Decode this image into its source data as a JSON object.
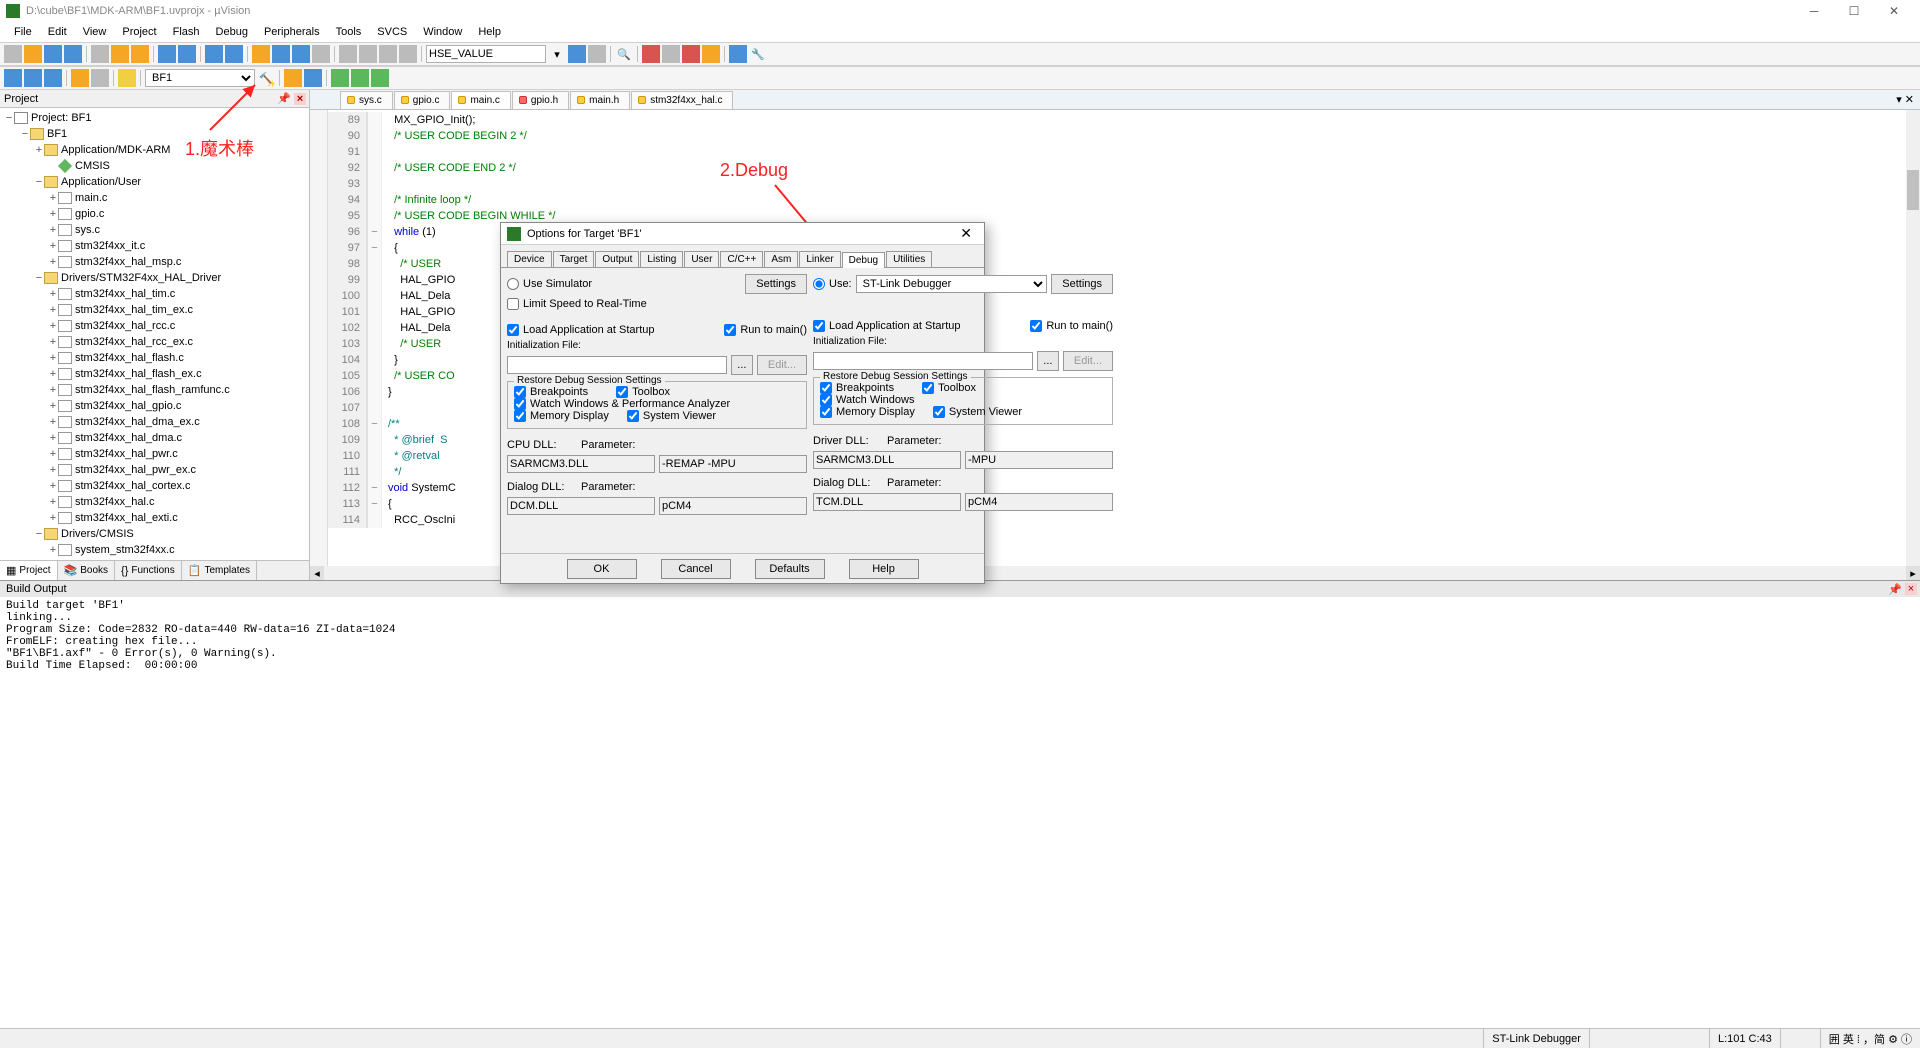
{
  "titlebar": {
    "title": "D:\\cube\\BF1\\MDK-ARM\\BF1.uvprojx - µVision"
  },
  "menu": [
    "File",
    "Edit",
    "View",
    "Project",
    "Flash",
    "Debug",
    "Peripherals",
    "Tools",
    "SVCS",
    "Window",
    "Help"
  ],
  "toolbar2": {
    "target": "BF1",
    "combo1": "HSE_VALUE"
  },
  "project_panel": {
    "title": "Project",
    "tabs": [
      "Project",
      "Books",
      "Functions",
      "Templates"
    ],
    "root": "Project: BF1",
    "tree": [
      {
        "d": 1,
        "t": "fold",
        "exp": "−",
        "txt": "BF1"
      },
      {
        "d": 2,
        "t": "fold",
        "exp": "+",
        "txt": "Application/MDK-ARM"
      },
      {
        "d": 3,
        "t": "diamond",
        "txt": "CMSIS"
      },
      {
        "d": 2,
        "t": "fold",
        "exp": "−",
        "txt": "Application/User"
      },
      {
        "d": 3,
        "t": "file",
        "exp": "+",
        "txt": "main.c"
      },
      {
        "d": 3,
        "t": "file",
        "exp": "+",
        "txt": "gpio.c"
      },
      {
        "d": 3,
        "t": "file",
        "exp": "+",
        "txt": "sys.c"
      },
      {
        "d": 3,
        "t": "file",
        "exp": "+",
        "txt": "stm32f4xx_it.c"
      },
      {
        "d": 3,
        "t": "file",
        "exp": "+",
        "txt": "stm32f4xx_hal_msp.c"
      },
      {
        "d": 2,
        "t": "fold",
        "exp": "−",
        "txt": "Drivers/STM32F4xx_HAL_Driver"
      },
      {
        "d": 3,
        "t": "file",
        "exp": "+",
        "txt": "stm32f4xx_hal_tim.c"
      },
      {
        "d": 3,
        "t": "file",
        "exp": "+",
        "txt": "stm32f4xx_hal_tim_ex.c"
      },
      {
        "d": 3,
        "t": "file",
        "exp": "+",
        "txt": "stm32f4xx_hal_rcc.c"
      },
      {
        "d": 3,
        "t": "file",
        "exp": "+",
        "txt": "stm32f4xx_hal_rcc_ex.c"
      },
      {
        "d": 3,
        "t": "file",
        "exp": "+",
        "txt": "stm32f4xx_hal_flash.c"
      },
      {
        "d": 3,
        "t": "file",
        "exp": "+",
        "txt": "stm32f4xx_hal_flash_ex.c"
      },
      {
        "d": 3,
        "t": "file",
        "exp": "+",
        "txt": "stm32f4xx_hal_flash_ramfunc.c"
      },
      {
        "d": 3,
        "t": "file",
        "exp": "+",
        "txt": "stm32f4xx_hal_gpio.c"
      },
      {
        "d": 3,
        "t": "file",
        "exp": "+",
        "txt": "stm32f4xx_hal_dma_ex.c"
      },
      {
        "d": 3,
        "t": "file",
        "exp": "+",
        "txt": "stm32f4xx_hal_dma.c"
      },
      {
        "d": 3,
        "t": "file",
        "exp": "+",
        "txt": "stm32f4xx_hal_pwr.c"
      },
      {
        "d": 3,
        "t": "file",
        "exp": "+",
        "txt": "stm32f4xx_hal_pwr_ex.c"
      },
      {
        "d": 3,
        "t": "file",
        "exp": "+",
        "txt": "stm32f4xx_hal_cortex.c"
      },
      {
        "d": 3,
        "t": "file",
        "exp": "+",
        "txt": "stm32f4xx_hal.c"
      },
      {
        "d": 3,
        "t": "file",
        "exp": "+",
        "txt": "stm32f4xx_hal_exti.c"
      },
      {
        "d": 2,
        "t": "fold",
        "exp": "−",
        "txt": "Drivers/CMSIS"
      },
      {
        "d": 3,
        "t": "file",
        "exp": "+",
        "txt": "system_stm32f4xx.c"
      }
    ]
  },
  "editor_tabs": [
    {
      "name": "sys.c",
      "kind": "c"
    },
    {
      "name": "gpio.c",
      "kind": "c"
    },
    {
      "name": "main.c",
      "kind": "c",
      "active": true
    },
    {
      "name": "gpio.h",
      "kind": "h"
    },
    {
      "name": "main.h",
      "kind": "c"
    },
    {
      "name": "stm32f4xx_hal.c",
      "kind": "c"
    }
  ],
  "code": [
    {
      "n": 89,
      "g": "",
      "segs": [
        {
          "c": "fn",
          "t": "  MX_GPIO_Init"
        },
        {
          "c": "",
          "t": "();"
        }
      ]
    },
    {
      "n": 90,
      "g": "",
      "segs": [
        {
          "c": "comm",
          "t": "  /* USER CODE BEGIN 2 */"
        }
      ]
    },
    {
      "n": 91,
      "g": "",
      "segs": [
        {
          "c": "",
          "t": ""
        }
      ]
    },
    {
      "n": 92,
      "g": "",
      "segs": [
        {
          "c": "comm",
          "t": "  /* USER CODE END 2 */"
        }
      ]
    },
    {
      "n": 93,
      "g": "",
      "segs": [
        {
          "c": "",
          "t": ""
        }
      ]
    },
    {
      "n": 94,
      "g": "",
      "segs": [
        {
          "c": "comm",
          "t": "  /* Infinite loop */"
        }
      ]
    },
    {
      "n": 95,
      "g": "",
      "segs": [
        {
          "c": "comm",
          "t": "  /* USER CODE BEGIN WHILE */"
        }
      ]
    },
    {
      "n": 96,
      "g": "−",
      "segs": [
        {
          "c": "kw",
          "t": "  while"
        },
        {
          "c": "",
          "t": " (1)"
        }
      ]
    },
    {
      "n": 97,
      "g": "−",
      "segs": [
        {
          "c": "",
          "t": "  {"
        }
      ]
    },
    {
      "n": 98,
      "g": "",
      "segs": [
        {
          "c": "comm",
          "t": "    /* USER"
        }
      ]
    },
    {
      "n": 99,
      "g": "",
      "segs": [
        {
          "c": "",
          "t": "    HAL_GPIO"
        }
      ]
    },
    {
      "n": 100,
      "g": "",
      "segs": [
        {
          "c": "",
          "t": "    HAL_Dela"
        }
      ]
    },
    {
      "n": 101,
      "g": "",
      "segs": [
        {
          "c": "",
          "t": "    HAL_GPIO"
        }
      ]
    },
    {
      "n": 102,
      "g": "",
      "segs": [
        {
          "c": "",
          "t": "    HAL_Dela"
        }
      ]
    },
    {
      "n": 103,
      "g": "",
      "segs": [
        {
          "c": "comm",
          "t": "    /* USER"
        }
      ]
    },
    {
      "n": 104,
      "g": "",
      "segs": [
        {
          "c": "",
          "t": "  }"
        }
      ]
    },
    {
      "n": 105,
      "g": "",
      "segs": [
        {
          "c": "comm",
          "t": "  /* USER CO"
        }
      ]
    },
    {
      "n": 106,
      "g": "",
      "segs": [
        {
          "c": "",
          "t": "}"
        }
      ]
    },
    {
      "n": 107,
      "g": "",
      "segs": [
        {
          "c": "",
          "t": ""
        }
      ]
    },
    {
      "n": 108,
      "g": "−",
      "segs": [
        {
          "c": "doc",
          "t": "/**"
        }
      ]
    },
    {
      "n": 109,
      "g": "",
      "segs": [
        {
          "c": "doc",
          "t": "  * @brief  S"
        }
      ]
    },
    {
      "n": 110,
      "g": "",
      "segs": [
        {
          "c": "doc",
          "t": "  * @retval"
        }
      ]
    },
    {
      "n": 111,
      "g": "",
      "segs": [
        {
          "c": "doc",
          "t": "  */"
        }
      ]
    },
    {
      "n": 112,
      "g": "−",
      "segs": [
        {
          "c": "kw",
          "t": "void"
        },
        {
          "c": "",
          "t": " SystemC"
        }
      ]
    },
    {
      "n": 113,
      "g": "−",
      "segs": [
        {
          "c": "",
          "t": "{"
        }
      ]
    },
    {
      "n": 114,
      "g": "",
      "segs": [
        {
          "c": "",
          "t": "  RCC_OscIni"
        }
      ]
    }
  ],
  "annotations": {
    "a1": "1.魔术棒",
    "a2": "2.Debug"
  },
  "dialog": {
    "title": "Options for Target 'BF1'",
    "tabs": [
      "Device",
      "Target",
      "Output",
      "Listing",
      "User",
      "C/C++",
      "Asm",
      "Linker",
      "Debug",
      "Utilities"
    ],
    "active_tab": "Debug",
    "left": {
      "use_sim": "Use Simulator",
      "settings": "Settings",
      "limit_speed": "Limit Speed to Real-Time",
      "load_startup": "Load Application at Startup",
      "run_main": "Run to main()",
      "init_file": "Initialization File:",
      "browse": "...",
      "edit": "Edit...",
      "restore_title": "Restore Debug Session Settings",
      "breakpoints": "Breakpoints",
      "toolbox": "Toolbox",
      "watch_perf": "Watch Windows & Performance Analyzer",
      "mem_disp": "Memory Display",
      "sys_viewer": "System Viewer",
      "cpu_dll_l": "CPU DLL:",
      "param_l": "Parameter:",
      "cpu_dll": "SARMCM3.DLL",
      "cpu_param": "-REMAP -MPU",
      "dlg_dll_l": "Dialog DLL:",
      "dlg_dll": "DCM.DLL",
      "dlg_param": "pCM4"
    },
    "right": {
      "use": "Use:",
      "debugger": "ST-Link Debugger",
      "settings": "Settings",
      "load_startup": "Load Application at Startup",
      "run_main": "Run to main()",
      "init_file": "Initialization File:",
      "browse": "...",
      "edit": "Edit...",
      "restore_title": "Restore Debug Session Settings",
      "breakpoints": "Breakpoints",
      "toolbox": "Toolbox",
      "watch": "Watch Windows",
      "mem_disp": "Memory Display",
      "sys_viewer": "System Viewer",
      "drv_dll_l": "Driver DLL:",
      "param_l": "Parameter:",
      "drv_dll": "SARMCM3.DLL",
      "drv_param": "-MPU",
      "dlg_dll_l": "Dialog DLL:",
      "dlg_dll": "TCM.DLL",
      "dlg_param": "pCM4"
    },
    "buttons": {
      "ok": "OK",
      "cancel": "Cancel",
      "defaults": "Defaults",
      "help": "Help"
    }
  },
  "build": {
    "title": "Build Output",
    "lines": "Build target 'BF1'\nlinking...\nProgram Size: Code=2832 RO-data=440 RW-data=16 ZI-data=1024\nFromELF: creating hex file...\n\"BF1\\BF1.axf\" - 0 Error(s), 0 Warning(s).\nBuild Time Elapsed:  00:00:00"
  },
  "status": {
    "debugger": "ST-Link Debugger",
    "pos": "L:101 C:43",
    "ime": "囲 英 ⁞ ，简 ⚙ ⓘ"
  }
}
